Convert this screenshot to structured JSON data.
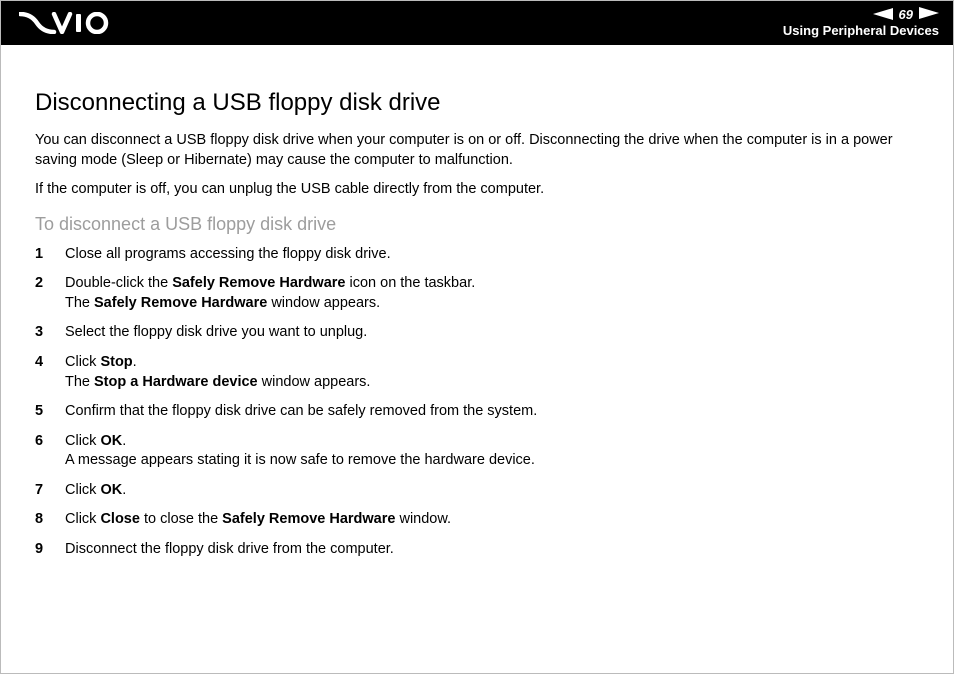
{
  "header": {
    "page_number": "69",
    "section": "Using Peripheral Devices"
  },
  "title": "Disconnecting a USB floppy disk drive",
  "intro1": "You can disconnect a USB floppy disk drive when your computer is on or off. Disconnecting the drive when the computer is in a power saving mode (Sleep or Hibernate) may cause the computer to malfunction.",
  "intro2": "If the computer is off, you can unplug the USB cable directly from the computer.",
  "subtitle": "To disconnect a USB floppy disk drive",
  "steps": {
    "s1": "Close all programs accessing the floppy disk drive.",
    "s2a": "Double-click the ",
    "s2b": "Safely Remove Hardware",
    "s2c": " icon on the taskbar.",
    "s2d": "The ",
    "s2e": "Safely Remove Hardware",
    "s2f": " window appears.",
    "s3": "Select the floppy disk drive you want to unplug.",
    "s4a": "Click ",
    "s4b": "Stop",
    "s4c": ".",
    "s4d": "The ",
    "s4e": "Stop a Hardware device",
    "s4f": " window appears.",
    "s5": "Confirm that the floppy disk drive can be safely removed from the system.",
    "s6a": "Click ",
    "s6b": "OK",
    "s6c": ".",
    "s6d": "A message appears stating it is now safe to remove the hardware device.",
    "s7a": "Click ",
    "s7b": "OK",
    "s7c": ".",
    "s8a": "Click ",
    "s8b": "Close",
    "s8c": " to close the ",
    "s8d": "Safely Remove Hardware",
    "s8e": " window.",
    "s9": "Disconnect the floppy disk drive from the computer."
  }
}
